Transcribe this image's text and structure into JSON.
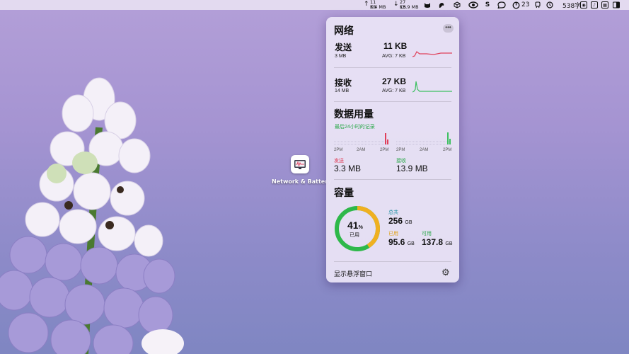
{
  "menubar": {
    "upload_rate": "11 KB",
    "upload_total": "3.4 MB",
    "download_rate": "27 KB",
    "download_total": "13.9 MB",
    "up_arrow": "↑",
    "down_arrow": "↓",
    "battery_value": "23",
    "word_count": "538字"
  },
  "desktop": {
    "app_label": "Network & Battery"
  },
  "panel": {
    "network": {
      "title": "网络",
      "more_label": "•••",
      "upload": {
        "label": "发送",
        "total": "3 MB",
        "rate": "11 KB",
        "avg": "AVG: 7 KB",
        "color": "#e0405a"
      },
      "download": {
        "label": "接收",
        "total": "14 MB",
        "rate": "27 KB",
        "avg": "AVG: 7 KB",
        "color": "#3cc060"
      }
    },
    "data_usage": {
      "title": "数据用量",
      "subtitle": "最后24小时的记录",
      "upload_axis": [
        "2PM",
        "2AM",
        "2PM"
      ],
      "download_axis": [
        "2PM",
        "2AM",
        "2PM"
      ],
      "upload_label": "发送",
      "upload_value": "3.3 MB",
      "download_label": "接收",
      "download_value": "13.9 MB"
    },
    "capacity": {
      "title": "容量",
      "percent": "41",
      "percent_sign": "%",
      "used_caption": "已用",
      "used_fraction": 0.41,
      "total_label": "总共",
      "total_value": "256",
      "used_label": "已用",
      "used_value": "95.6",
      "available_label": "可用",
      "available_value": "137.8",
      "unit": "GB",
      "ring_used_color": "#f0b020",
      "ring_free_color": "#2eb84a"
    },
    "footer": {
      "floating_label": "显示悬浮窗口",
      "settings_icon": "gear-icon"
    }
  }
}
